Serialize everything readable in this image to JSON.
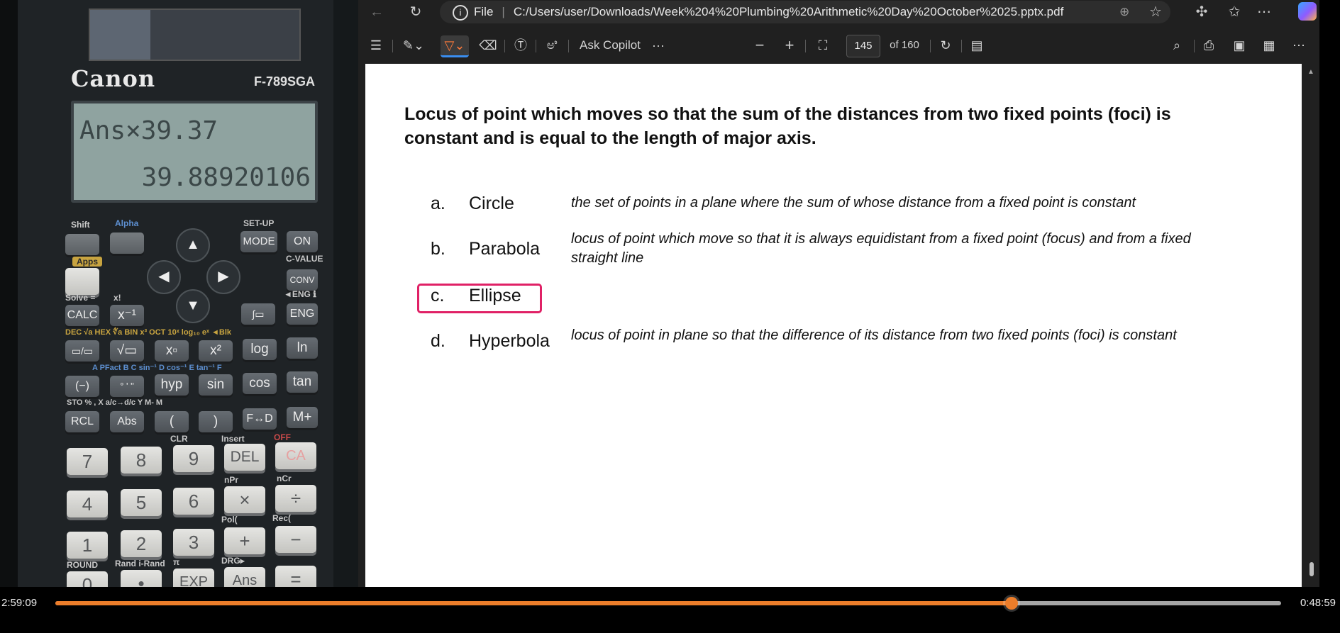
{
  "calculator": {
    "brand": "Canon",
    "model": "F-789SGA",
    "display_input": "Ans×39.37",
    "display_output": "39.88920106",
    "top_labels": {
      "shift": "Shift",
      "alpha": "Alpha",
      "setup": "SET-UP",
      "apps": "Apps",
      "cvalue": "C-VALUE",
      "solve": "Solve =",
      "factorial": "x!",
      "eng_left": "◄ENG ℹ"
    },
    "keys": {
      "mode": "MODE",
      "on": "ON",
      "conv": "CONV",
      "calc": "CALC",
      "inverse": "x⁻¹",
      "eng": "ENG",
      "fraction": "▭/▭",
      "sqrt": "√▭",
      "power": "x▫",
      "square": "x²",
      "log": "log",
      "ln": "ln",
      "negate": "(−)",
      "degree": "° ' \"",
      "hyp": "hyp",
      "sin": "sin",
      "cos": "cos",
      "tan": "tan",
      "rcl": "RCL",
      "abs": "Abs",
      "lparen": "(",
      "rparen": ")",
      "fd": "F↔D",
      "mplus": "M+",
      "seven": "7",
      "eight": "8",
      "nine": "9",
      "del": "DEL",
      "ca": "CA",
      "four": "4",
      "five": "5",
      "six": "6",
      "times": "×",
      "divide": "÷",
      "one": "1",
      "two": "2",
      "three": "3",
      "plus": "+",
      "minus": "−",
      "zero": "0",
      "dot": "•",
      "exp": "EXP",
      "ans": "Ans",
      "equals": "="
    },
    "sub_labels": {
      "dec_hex": "DEC  √a HEX  ∜a  BIN  x³ OCT  10ˣ  log₁₀  eˣ ◄Blk",
      "sin_row": "A   PFact  B        C  sin⁻¹  D  cos⁻¹  E  tan⁻¹  F",
      "sto_row": "STO            %      ,    X a/c→d/c Y   M-    M",
      "clr": "CLR",
      "insert": "Insert",
      "off": "OFF",
      "npr": "nPr",
      "ncr": "nCr",
      "pol": "Pol(",
      "rec": "Rec(",
      "round": "ROUND",
      "rand": "Rand  i-Rand",
      "pi": "π",
      "drg": "DRG▸"
    }
  },
  "browser": {
    "address_prefix": "File",
    "url": "C:/Users/user/Downloads/Week%204%20Plumbing%20Arithmetic%20Day%20October%2025.pptx.pdf",
    "icons": [
      "back-icon",
      "refresh-icon",
      "zoom-icon",
      "favorite-star-icon",
      "extensions-icon",
      "favorites-icon",
      "more-icon",
      "copilot-icon"
    ]
  },
  "pdf_toolbar": {
    "ask_copilot": "Ask Copilot",
    "read_aloud": "ಅಿ",
    "more": "···",
    "zoom_out": "−",
    "zoom_in": "+",
    "current_page": "145",
    "total_pages": "of 160"
  },
  "slide": {
    "question": "Locus of point which moves so that the sum of the distances from two fixed points (foci) is constant and is equal to the length of major axis.",
    "options": [
      {
        "letter": "a.",
        "name": "Circle",
        "description": "the set of points in a plane where the sum of whose distance from a fixed point is constant"
      },
      {
        "letter": "b.",
        "name": "Parabola",
        "description": "locus of point which move so that it is always equidistant from a fixed point (focus) and from a fixed straight line"
      },
      {
        "letter": "c.",
        "name": "Ellipse",
        "description": ""
      },
      {
        "letter": "d.",
        "name": "Hyperbola",
        "description": "locus of point in plane so that the difference of its distance from two fixed points (foci) is constant"
      }
    ],
    "highlighted_option": "c.",
    "highlight_color": "#e02166"
  },
  "player": {
    "elapsed": "2:59:09",
    "remaining": "0:48:59",
    "progress": 0.78,
    "accent": "#ec7d2a"
  }
}
